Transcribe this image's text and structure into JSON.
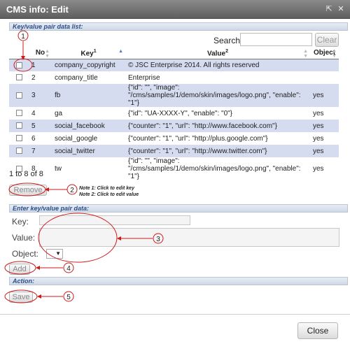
{
  "window": {
    "title": "CMS info: Edit"
  },
  "list_section": {
    "header": "Key/value pair data list:",
    "search_label": "Search:",
    "search_value": "",
    "clear_label": "Clear",
    "columns": {
      "no": "No",
      "key": "Key",
      "key_sup": "1",
      "value": "Value",
      "value_sup": "2",
      "object": "Object"
    },
    "rows": [
      {
        "no": "1",
        "key": "company_copyright",
        "value": "© JSC Enterprise 2014. All rights reserved",
        "object": ""
      },
      {
        "no": "2",
        "key": "company_title",
        "value": "Enterprise",
        "object": ""
      },
      {
        "no": "3",
        "key": "fb",
        "value": "{\"id\": \"\", \"image\": \"/cms/samples/1/demo/skin/images/logo.png\", \"enable\": \"1\"}",
        "object": "yes"
      },
      {
        "no": "4",
        "key": "ga",
        "value": "{\"id\": \"UA-XXXX-Y\", \"enable\": \"0\"}",
        "object": "yes"
      },
      {
        "no": "5",
        "key": "social_facebook",
        "value": "{\"counter\": \"1\", \"url\": \"http://www.facebook.com\"}",
        "object": "yes"
      },
      {
        "no": "6",
        "key": "social_google",
        "value": "{\"counter\": \"1\", \"url\": \"http://plus.google.com\"}",
        "object": "yes"
      },
      {
        "no": "7",
        "key": "social_twitter",
        "value": "{\"counter\": \"1\", \"url\": \"http://www.twitter.com\"}",
        "object": "yes"
      },
      {
        "no": "8",
        "key": "tw",
        "value": "{\"id\": \"\", \"image\": \"/cms/samples/1/demo/skin/images/logo.png\", \"enable\": \"1\"}",
        "object": "yes"
      }
    ],
    "info": "1 to 8 of 8",
    "remove_label": "Remove",
    "note1": "Note 1: Click to edit key",
    "note2": "Note 2: Click to edit value"
  },
  "entry_section": {
    "header": "Enter key/value pair data:",
    "key_label": "Key:",
    "value_label": "Value:",
    "object_label": "Object:",
    "key_value": "",
    "value_value": "",
    "object_selected": "",
    "add_label": "Add"
  },
  "action_section": {
    "header": "Action:",
    "save_label": "Save"
  },
  "footer": {
    "close_label": "Close"
  },
  "callouts": [
    "1",
    "2",
    "3",
    "4",
    "5"
  ],
  "colors": {
    "titlebar": "#6f6f6f",
    "header_text": "#2c4f86",
    "row_alt": "#d6dcf0",
    "annotation": "#cc1a1a"
  }
}
